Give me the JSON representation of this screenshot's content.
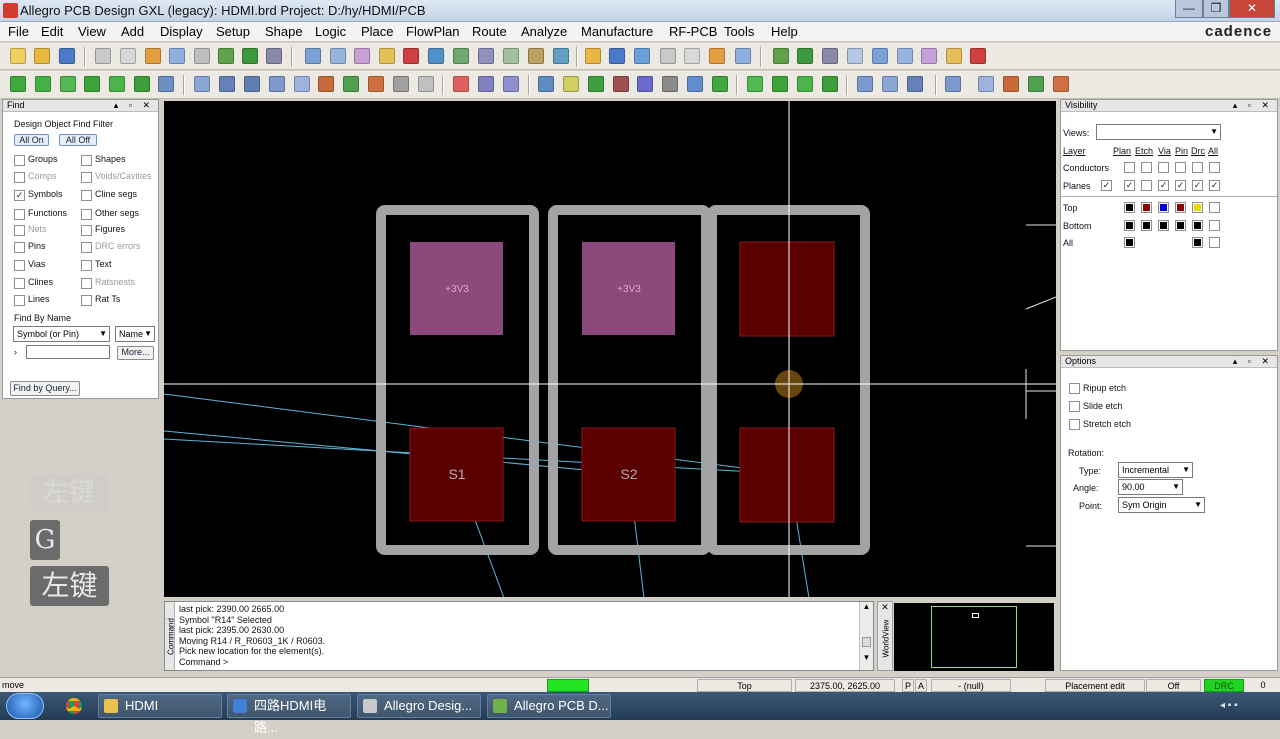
{
  "window": {
    "title": "Allegro PCB Design GXL (legacy): HDMI.brd  Project: D:/hy/HDMI/PCB",
    "brand": "cadence"
  },
  "menu": [
    "File",
    "Edit",
    "View",
    "Add",
    "Display",
    "Setup",
    "Shape",
    "Logic",
    "Place",
    "FlowPlan",
    "Route",
    "Analyze",
    "Manufacture",
    "RF-PCB",
    "Tools",
    "Help"
  ],
  "find": {
    "title": "Find",
    "filter_title": "Design Object Find Filter",
    "all_on": "All On",
    "all_off": "All Off",
    "left": [
      {
        "label": "Groups",
        "checked": false,
        "dim": false
      },
      {
        "label": "Comps",
        "checked": false,
        "dim": true
      },
      {
        "label": "Symbols",
        "checked": true,
        "dim": false
      },
      {
        "label": "Functions",
        "checked": false,
        "dim": false
      },
      {
        "label": "Nets",
        "checked": false,
        "dim": true
      },
      {
        "label": "Pins",
        "checked": false,
        "dim": false
      },
      {
        "label": "Vias",
        "checked": false,
        "dim": false
      },
      {
        "label": "Clines",
        "checked": false,
        "dim": false
      },
      {
        "label": "Lines",
        "checked": false,
        "dim": false
      }
    ],
    "right": [
      {
        "label": "Shapes",
        "checked": false,
        "dim": false
      },
      {
        "label": "Voids/Cavities",
        "checked": false,
        "dim": true
      },
      {
        "label": "Cline segs",
        "checked": false,
        "dim": false
      },
      {
        "label": "Other segs",
        "checked": false,
        "dim": false
      },
      {
        "label": "Figures",
        "checked": false,
        "dim": false
      },
      {
        "label": "DRC errors",
        "checked": false,
        "dim": true
      },
      {
        "label": "Text",
        "checked": false,
        "dim": false
      },
      {
        "label": "Ratsnests",
        "checked": false,
        "dim": true
      },
      {
        "label": "Rat Ts",
        "checked": false,
        "dim": false
      }
    ],
    "by_name": "Find By Name",
    "type_select": "Symbol (or Pin)",
    "name_select": "Name",
    "more": "More...",
    "query": "Find by Query..."
  },
  "visibility": {
    "title": "Visibility",
    "views_label": "Views:",
    "headers": [
      "Layer",
      "Plan",
      "Etch",
      "Via",
      "Pin",
      "Drc",
      "All"
    ],
    "conductors": "Conductors",
    "planes": "Planes",
    "layers": [
      {
        "name": "Top",
        "colors": [
          "#000000",
          "#8b0000",
          "#0000cc",
          "#8b0000",
          "#e8d800"
        ]
      },
      {
        "name": "Bottom",
        "colors": [
          "#000000",
          "#000000",
          "#000000",
          "#000000",
          "#000000"
        ]
      },
      {
        "name": "All",
        "colors": [
          "#000000"
        ]
      }
    ]
  },
  "options": {
    "title": "Options",
    "checks": [
      "Ripup etch",
      "Slide etch",
      "Stretch etch"
    ],
    "rotation": "Rotation:",
    "type_label": "Type:",
    "type_value": "Incremental",
    "angle_label": "Angle:",
    "angle_value": "90.00",
    "point_label": "Point:",
    "point_value": "Sym Origin"
  },
  "canvas": {
    "pad_net": "+3V3",
    "refdes": [
      "S1",
      "S2"
    ],
    "colors": {
      "outline": "#a3a3a3",
      "pad_power": "#8c4a7c",
      "pad_sig": "#5a0000",
      "ratsnest": "#5fb4d8",
      "cursor": "#ffffff"
    }
  },
  "command": {
    "lines": [
      "last pick:  2390.00 2665.00",
      "Symbol \"R14\" Selected",
      "last pick:  2395.00 2630.00",
      "Moving R14 / R_R0603_1K / R0603.",
      "Pick new location for the element(s).",
      "Command >"
    ],
    "side_label": "Command",
    "world_label": "WorldView"
  },
  "status": {
    "mode": "move",
    "layer": "Top",
    "coords": "2375.00, 2625.00",
    "p": "P",
    "a": "A",
    "null": "- (null)",
    "edit": "Placement edit",
    "off": "Off",
    "drc": "DRC",
    "drc_count": "0"
  },
  "overlay": {
    "key_top": "左键",
    "key_g": "G",
    "key_bottom": "左键"
  },
  "taskbar": [
    {
      "label": "HDMI",
      "icon": "#e8c24a"
    },
    {
      "label": "四路HDMI电路...",
      "icon": "#3f7fd6"
    },
    {
      "label": "Allegro Desig...",
      "icon": "#c8c8c8"
    },
    {
      "label": "Allegro PCB D...",
      "icon": "#6db34a"
    }
  ]
}
